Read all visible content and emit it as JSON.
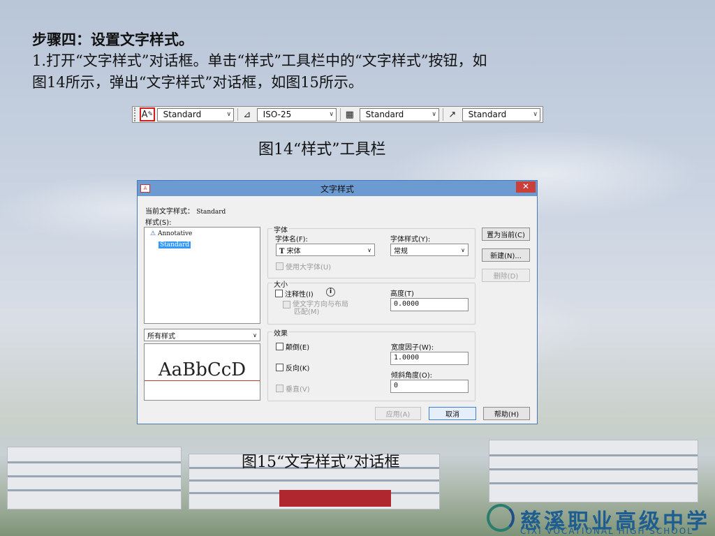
{
  "slide": {
    "heading": "步骤四：设置文字样式。",
    "para_line1": "1.打开“文字样式”对话框。单击“样式”工具栏中的“文字样式”按钮，如",
    "para_line2": "图14所示，弹出“文字样式”对话框，如图15所示。",
    "caption14": "图14“样式”工具栏",
    "caption15": "图15“文字样式”对话框"
  },
  "toolbar": {
    "combo1": "Standard",
    "combo2": "ISO-25",
    "combo3": "Standard",
    "combo4": "Standard",
    "arrow": "∨"
  },
  "dialog": {
    "title": "文字样式",
    "close": "✕",
    "current_style_label": "当前文字样式：",
    "current_style_value": "Standard",
    "styles_label": "样式(S):",
    "styles": [
      "Annotative",
      "Standard"
    ],
    "filter_combo": "所有样式",
    "preview_text": "AaBbCcD",
    "font_group": "字体",
    "font_name_label": "字体名(F):",
    "font_name_value": "宋体",
    "font_style_label": "字体样式(Y):",
    "font_style_value": "常规",
    "bigfont_label": "使用大字体(U)",
    "size_group": "大小",
    "annotative_label": "注释性(I)",
    "match_orientation_label_1": "使文字方向与布局",
    "match_orientation_label_2": "匹配(M)",
    "height_label": "高度(T)",
    "height_value": "0.0000",
    "effects_group": "效果",
    "upside_down_label": "颠倒(E)",
    "backwards_label": "反向(K)",
    "vertical_label": "垂直(V)",
    "width_factor_label": "宽度因子(W):",
    "width_factor_value": "1.0000",
    "oblique_label": "倾斜角度(O):",
    "oblique_value": "0",
    "set_current_btn": "置为当前(C)",
    "new_btn": "新建(N)...",
    "delete_btn": "删除(D)",
    "apply_btn": "应用(A)",
    "cancel_btn": "取消",
    "help_btn": "帮助(H)"
  },
  "footer": {
    "school_name": "慈溪职业高级中学",
    "school_en": "CIXI VOCATIONAL HIGH SCHOOL"
  }
}
